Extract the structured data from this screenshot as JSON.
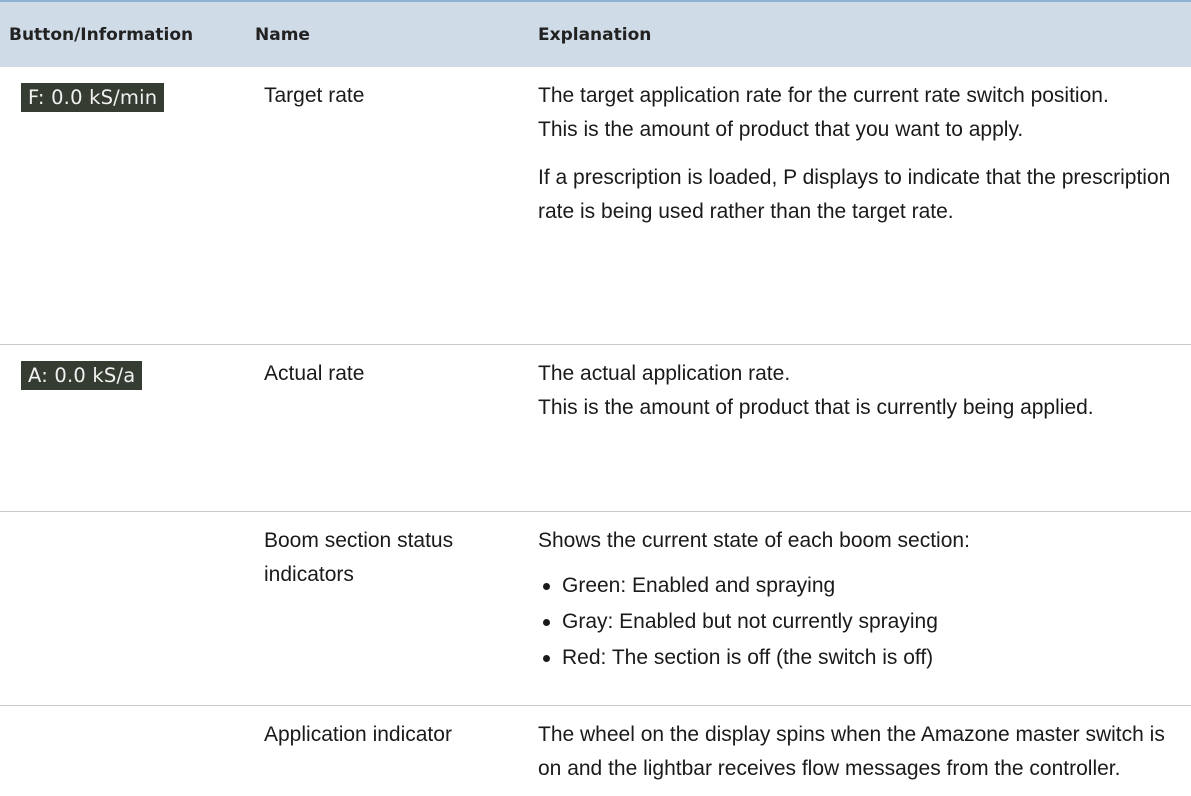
{
  "headers": {
    "button_info": "Button/Information",
    "name": "Name",
    "explanation": "Explanation"
  },
  "rows": [
    {
      "badge": "F: 0.0 kS/min",
      "name": "Target rate",
      "exp": [
        "The target application rate for the current rate switch position.",
        "This is the amount of product that you want to apply.",
        "If a prescription is loaded, P displays to indicate that the prescription rate is being used rather than the target rate."
      ]
    },
    {
      "badge": "A: 0.0 kS/a",
      "name": "Actual rate",
      "exp": [
        "The actual application rate.",
        "This is the amount of product that is currently being applied."
      ]
    },
    {
      "badge": "",
      "name": "Boom section status indicators",
      "exp": [
        "Shows the current state of each boom section:"
      ],
      "bullets": [
        "Green: Enabled and spraying",
        "Gray: Enabled but not currently spraying",
        "Red: The section is off (the switch is off)"
      ]
    },
    {
      "badge": "",
      "name": "Application indicator",
      "exp": [
        "The wheel on the display spins when the Amazone master switch is on and the lightbar receives flow messages from the controller."
      ]
    }
  ],
  "colors": {
    "header_bg": "#cfdbe6",
    "badge_bg": "#353d32",
    "badge_text": "#f2f2f2"
  }
}
